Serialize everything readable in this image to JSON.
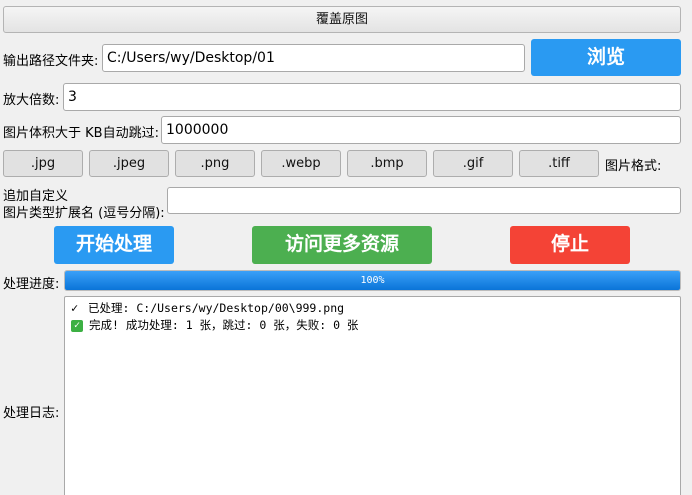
{
  "overwrite_button": "覆盖原图",
  "output": {
    "label": "输出路径文件夹:",
    "value": "C:/Users/wy/Desktop/01",
    "browse_label": "浏览"
  },
  "scale": {
    "label": "放大倍数:",
    "value": "3"
  },
  "skip": {
    "label": "图片体积大于 KB自动跳过:",
    "value": "1000000"
  },
  "formats": {
    "items": [
      ".jpg",
      ".jpeg",
      ".png",
      ".webp",
      ".bmp",
      ".gif",
      ".tiff"
    ],
    "label": "图片格式:"
  },
  "custom_ext": {
    "label_line1": "追加自定义",
    "label_line2": "图片类型扩展名 (逗号分隔):",
    "value": ""
  },
  "actions": {
    "start": "开始处理",
    "more": "访问更多资源",
    "stop": "停止"
  },
  "colors": {
    "blue": "#2a9af2",
    "green": "#4caf50",
    "red": "#f44336"
  },
  "progress": {
    "label": "处理进度:",
    "percent": 100,
    "text": "100%"
  },
  "log": {
    "label": "处理日志:",
    "lines": [
      {
        "icon": "check-icon",
        "text": "已处理: C:/Users/wy/Desktop/00\\999.png"
      },
      {
        "icon": "green-check-icon",
        "text": "完成! 成功处理: 1 张，跳过: 0 张，失败: 0 张"
      }
    ]
  }
}
